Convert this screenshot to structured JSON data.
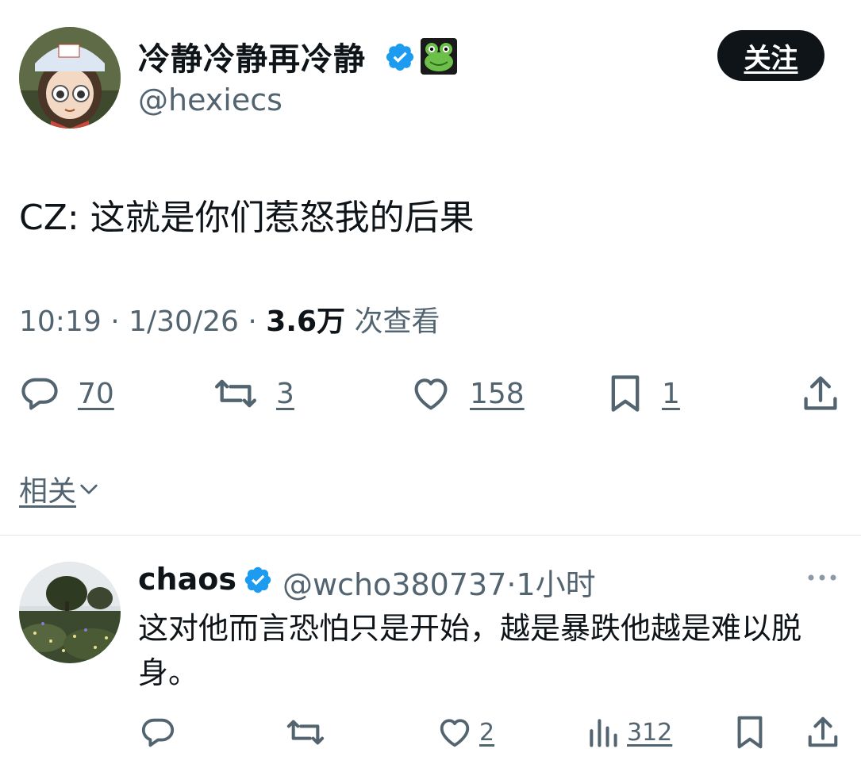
{
  "tweet": {
    "author": {
      "display_name": "冷静冷静再冷静",
      "handle": "@hexiecs",
      "verified": true,
      "badge_emoji": "frog-emoji"
    },
    "follow_label": "关注",
    "text": "CZ: 这就是你们惹怒我的后果",
    "time": "10:19",
    "date": "1/30/26",
    "separator": "·",
    "views_count": "3.6万",
    "views_label": "次查看",
    "stats": {
      "replies": "70",
      "retweets": "3",
      "likes": "158",
      "bookmarks": "1"
    }
  },
  "related_label": "相关",
  "reply": {
    "display_name": "chaos",
    "handle": "@wcho380737",
    "time_ago": "1小时",
    "verified": true,
    "text": "这对他而言恐怕只是开始，越是暴跌他越是难以脱身。",
    "stats": {
      "likes": "2",
      "views": "312"
    }
  },
  "colors": {
    "text_primary": "#0f1419",
    "text_secondary": "#536471",
    "verified_blue": "#1d9bf0",
    "follow_bg": "#0f1419",
    "divider": "#e1e6ea"
  }
}
